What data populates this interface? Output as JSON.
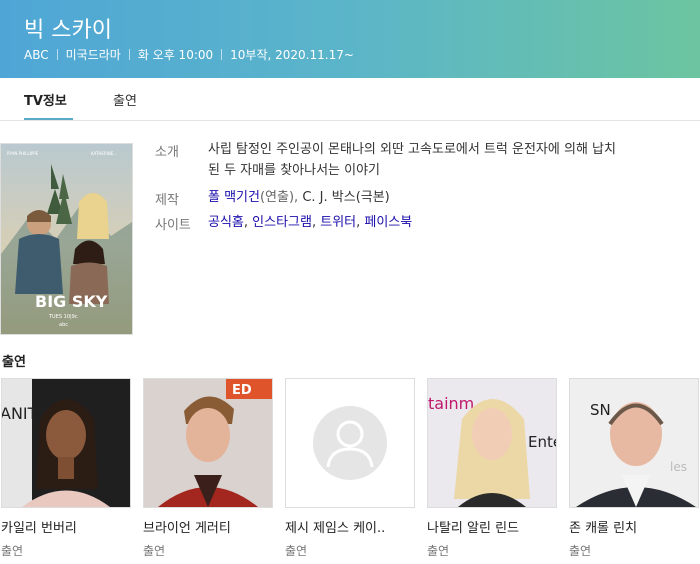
{
  "header": {
    "title": "빅 스카이",
    "meta": [
      "ABC",
      "미국드라마",
      "화 오후 10:00",
      "10부작, 2020.11.17~"
    ]
  },
  "tabs": [
    {
      "label": "TV정보",
      "active": true
    },
    {
      "label": "출연",
      "active": false
    }
  ],
  "poster": {
    "top_text_left": "RYAN PHILLIPPE",
    "top_text_right": "KATHERINE...",
    "title": "BIG SKY",
    "date": "TUES 10|9c",
    "network": "abc"
  },
  "info": {
    "intro_label": "소개",
    "intro_line1": "사립 탐정인 주인공이 몬태나의 외딴 고속도로에서 트럭 운전자에 의해 납치",
    "intro_line2": "된 두 자매를 찾아나서는 이야기",
    "production_label": "제작",
    "director_name": "폴 맥기건",
    "director_role": "(연출), ",
    "writer_text": "C. J. 박스(극본)",
    "site_label": "사이트",
    "sites": [
      "공식홈",
      "인스타그램",
      "트위터",
      "페이스북"
    ]
  },
  "cast_section_title": "출연",
  "cast": [
    {
      "name": "카일리 번버리",
      "role": "출연"
    },
    {
      "name": "브라이언 게러티",
      "role": "출연"
    },
    {
      "name": "제시 제임스 케이..",
      "role": "출연"
    },
    {
      "name": "나탈리 알린 린드",
      "role": "출연"
    },
    {
      "name": "존 캐롤 린치",
      "role": "출연"
    }
  ],
  "photo_text": {
    "cast1": "ANITY",
    "cast2": "ED",
    "cast4_top": "tainm",
    "cast4_side": "Ente",
    "cast5_top": "SN",
    "cast5_side": "les"
  },
  "colors": {
    "header_start": "#4fa6d6",
    "header_end": "#6cc5a0",
    "link": "#1a0dab",
    "tab_underline": "#5aa9c7"
  }
}
